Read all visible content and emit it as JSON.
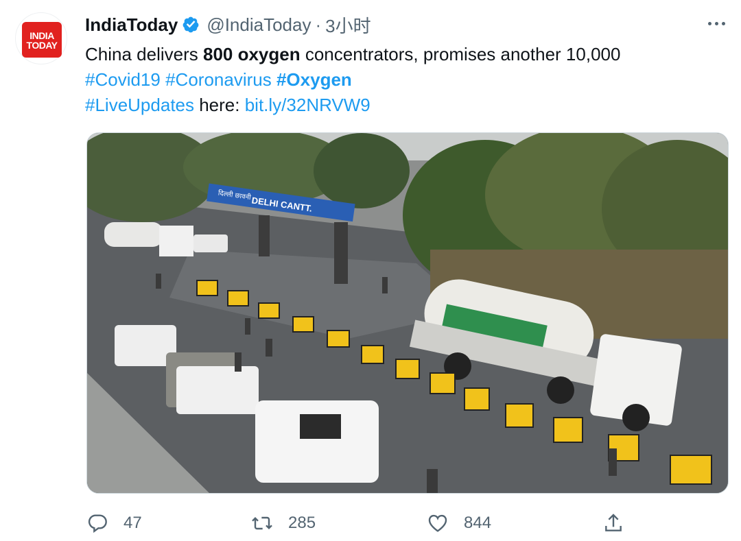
{
  "author": {
    "name": "IndiaToday",
    "handle": "@IndiaToday",
    "separator": "·",
    "time": "3小时",
    "avatar_text": [
      "INDIA",
      "TODAY"
    ]
  },
  "tweet": {
    "line1_pre": "China delivers ",
    "line1_bold": "800 oxygen",
    "line1_post": " concentrators, promises another 10,000",
    "hashtags": [
      "#Covid19",
      "#Coronavirus",
      "#Oxygen"
    ],
    "line3_tag": "#LiveUpdates",
    "line3_mid": " here: ",
    "link": "bit.ly/32NRVW9"
  },
  "media": {
    "sign_text": "DELHI CANTT.",
    "sign_hindi": "दिल्ली छावनी"
  },
  "actions": {
    "replies": "47",
    "retweets": "285",
    "likes": "844"
  },
  "icons": [
    "more-icon",
    "verified-icon",
    "reply-icon",
    "retweet-icon",
    "like-icon",
    "share-icon"
  ],
  "colors": {
    "accent": "#1d9bf0",
    "text": "#0f1419",
    "muted": "#536471",
    "logo_red": "#e1211f"
  }
}
